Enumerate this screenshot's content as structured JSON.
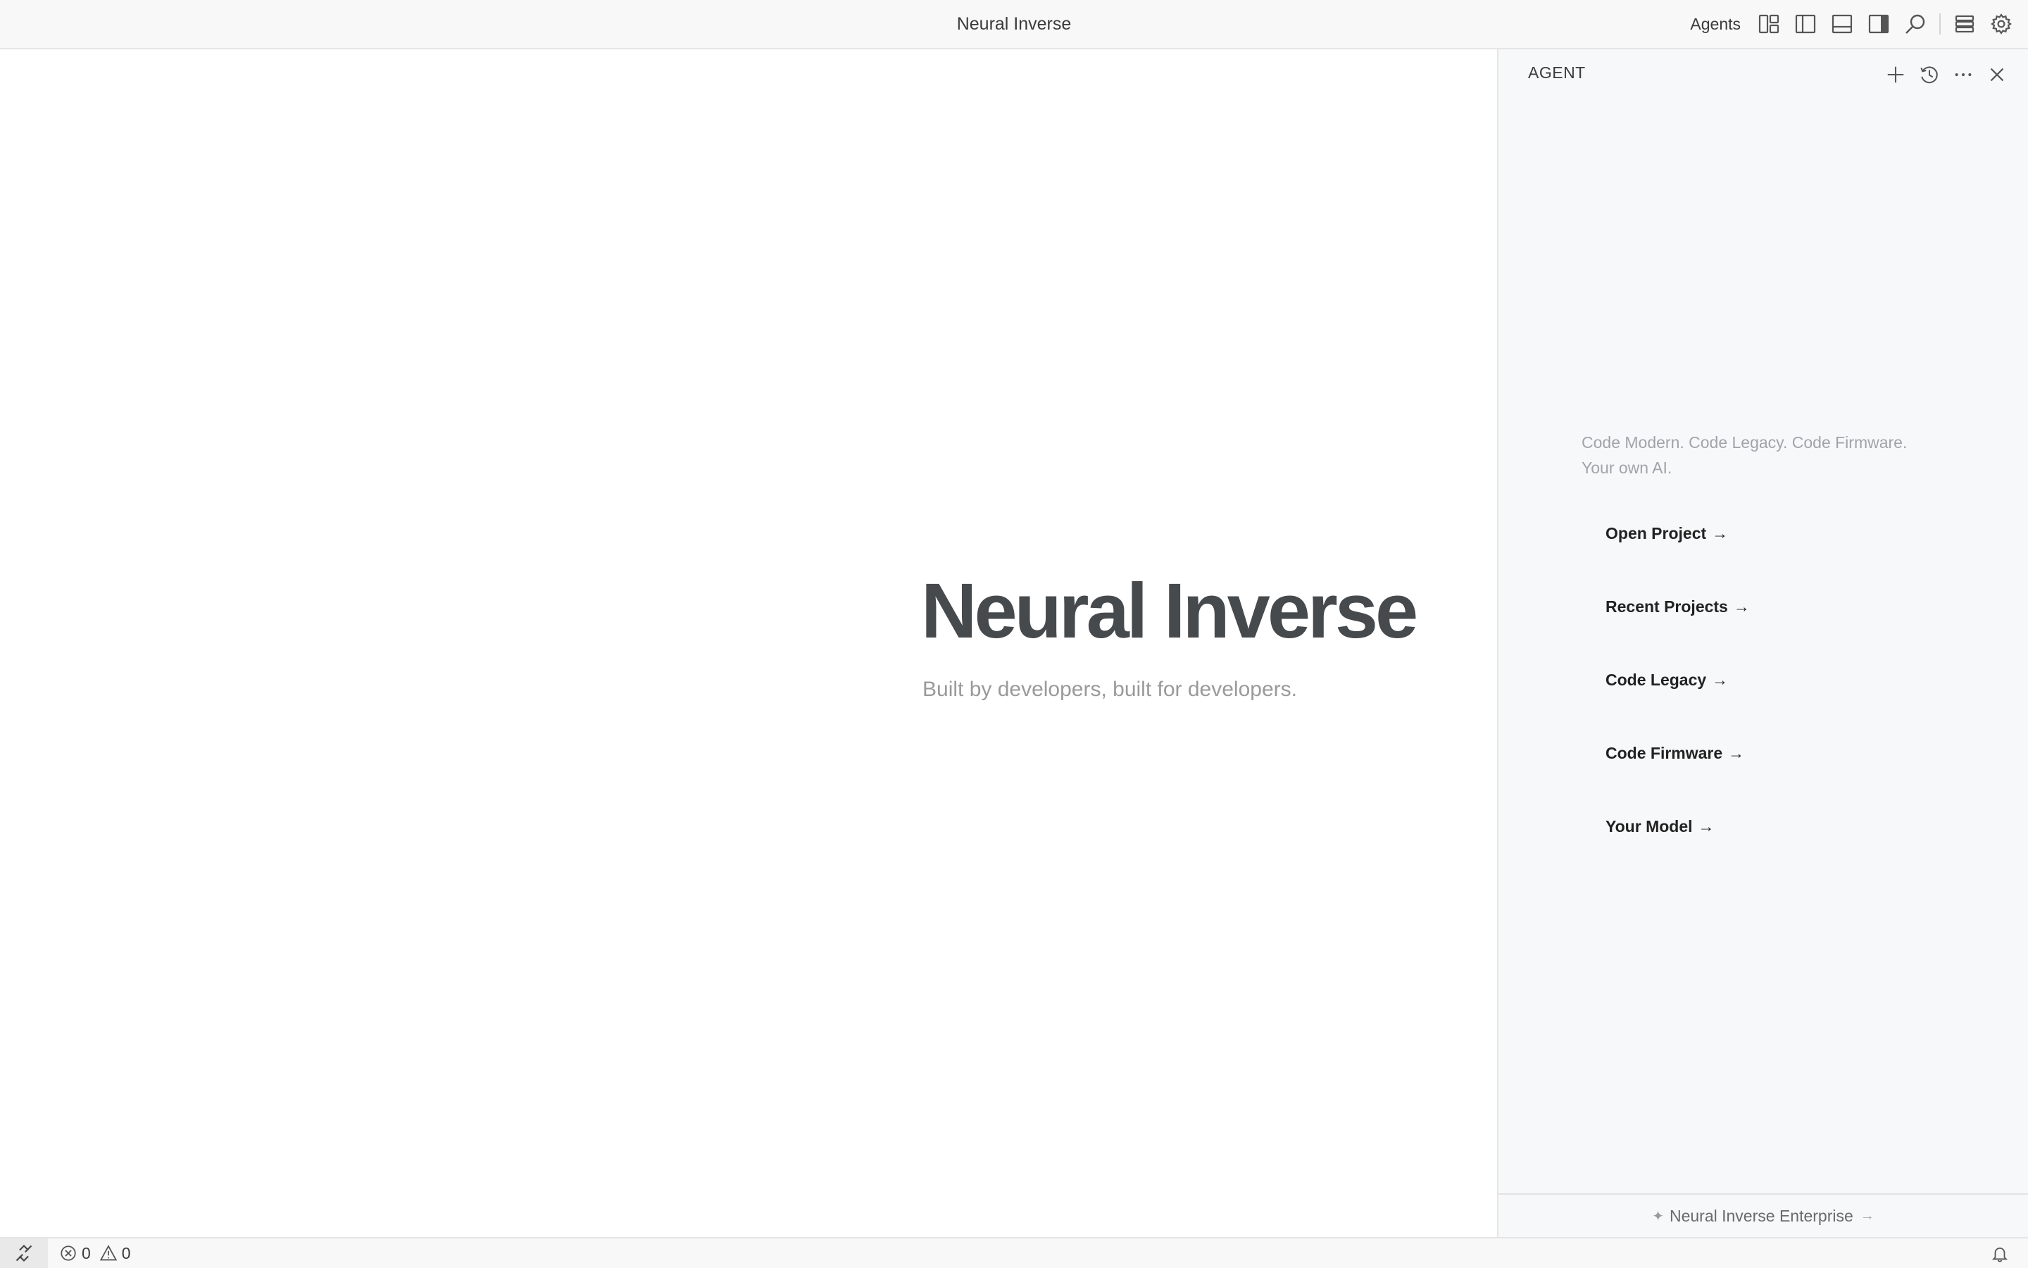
{
  "titlebar": {
    "title": "Neural Inverse",
    "agents_label": "Agents",
    "icons": [
      "customize-layout-icon",
      "toggle-primary-sidebar-icon",
      "toggle-panel-icon",
      "toggle-secondary-sidebar-icon",
      "search-icon",
      "accounts-icon",
      "settings-gear-icon"
    ]
  },
  "editor": {
    "hero_title": "Neural Inverse",
    "hero_subtitle": "Built by developers, built for developers."
  },
  "agent_panel": {
    "title": "AGENT",
    "actions": [
      "new-chat-icon",
      "history-icon",
      "more-icon",
      "close-icon"
    ],
    "tagline_line1": "Code Modern. Code Legacy. Code Firmware.",
    "tagline_line2": "Your own AI.",
    "links": [
      {
        "label": "Open Project",
        "arrow": "→"
      },
      {
        "label": "Recent Projects",
        "arrow": "→"
      },
      {
        "label": "Code Legacy",
        "arrow": "→"
      },
      {
        "label": "Code Firmware",
        "arrow": "→"
      },
      {
        "label": "Your Model",
        "arrow": "→"
      }
    ],
    "footer": {
      "sparkle": "✦",
      "label": "Neural Inverse Enterprise",
      "arrow": "→"
    }
  },
  "statusbar": {
    "errors": "0",
    "warnings": "0"
  }
}
